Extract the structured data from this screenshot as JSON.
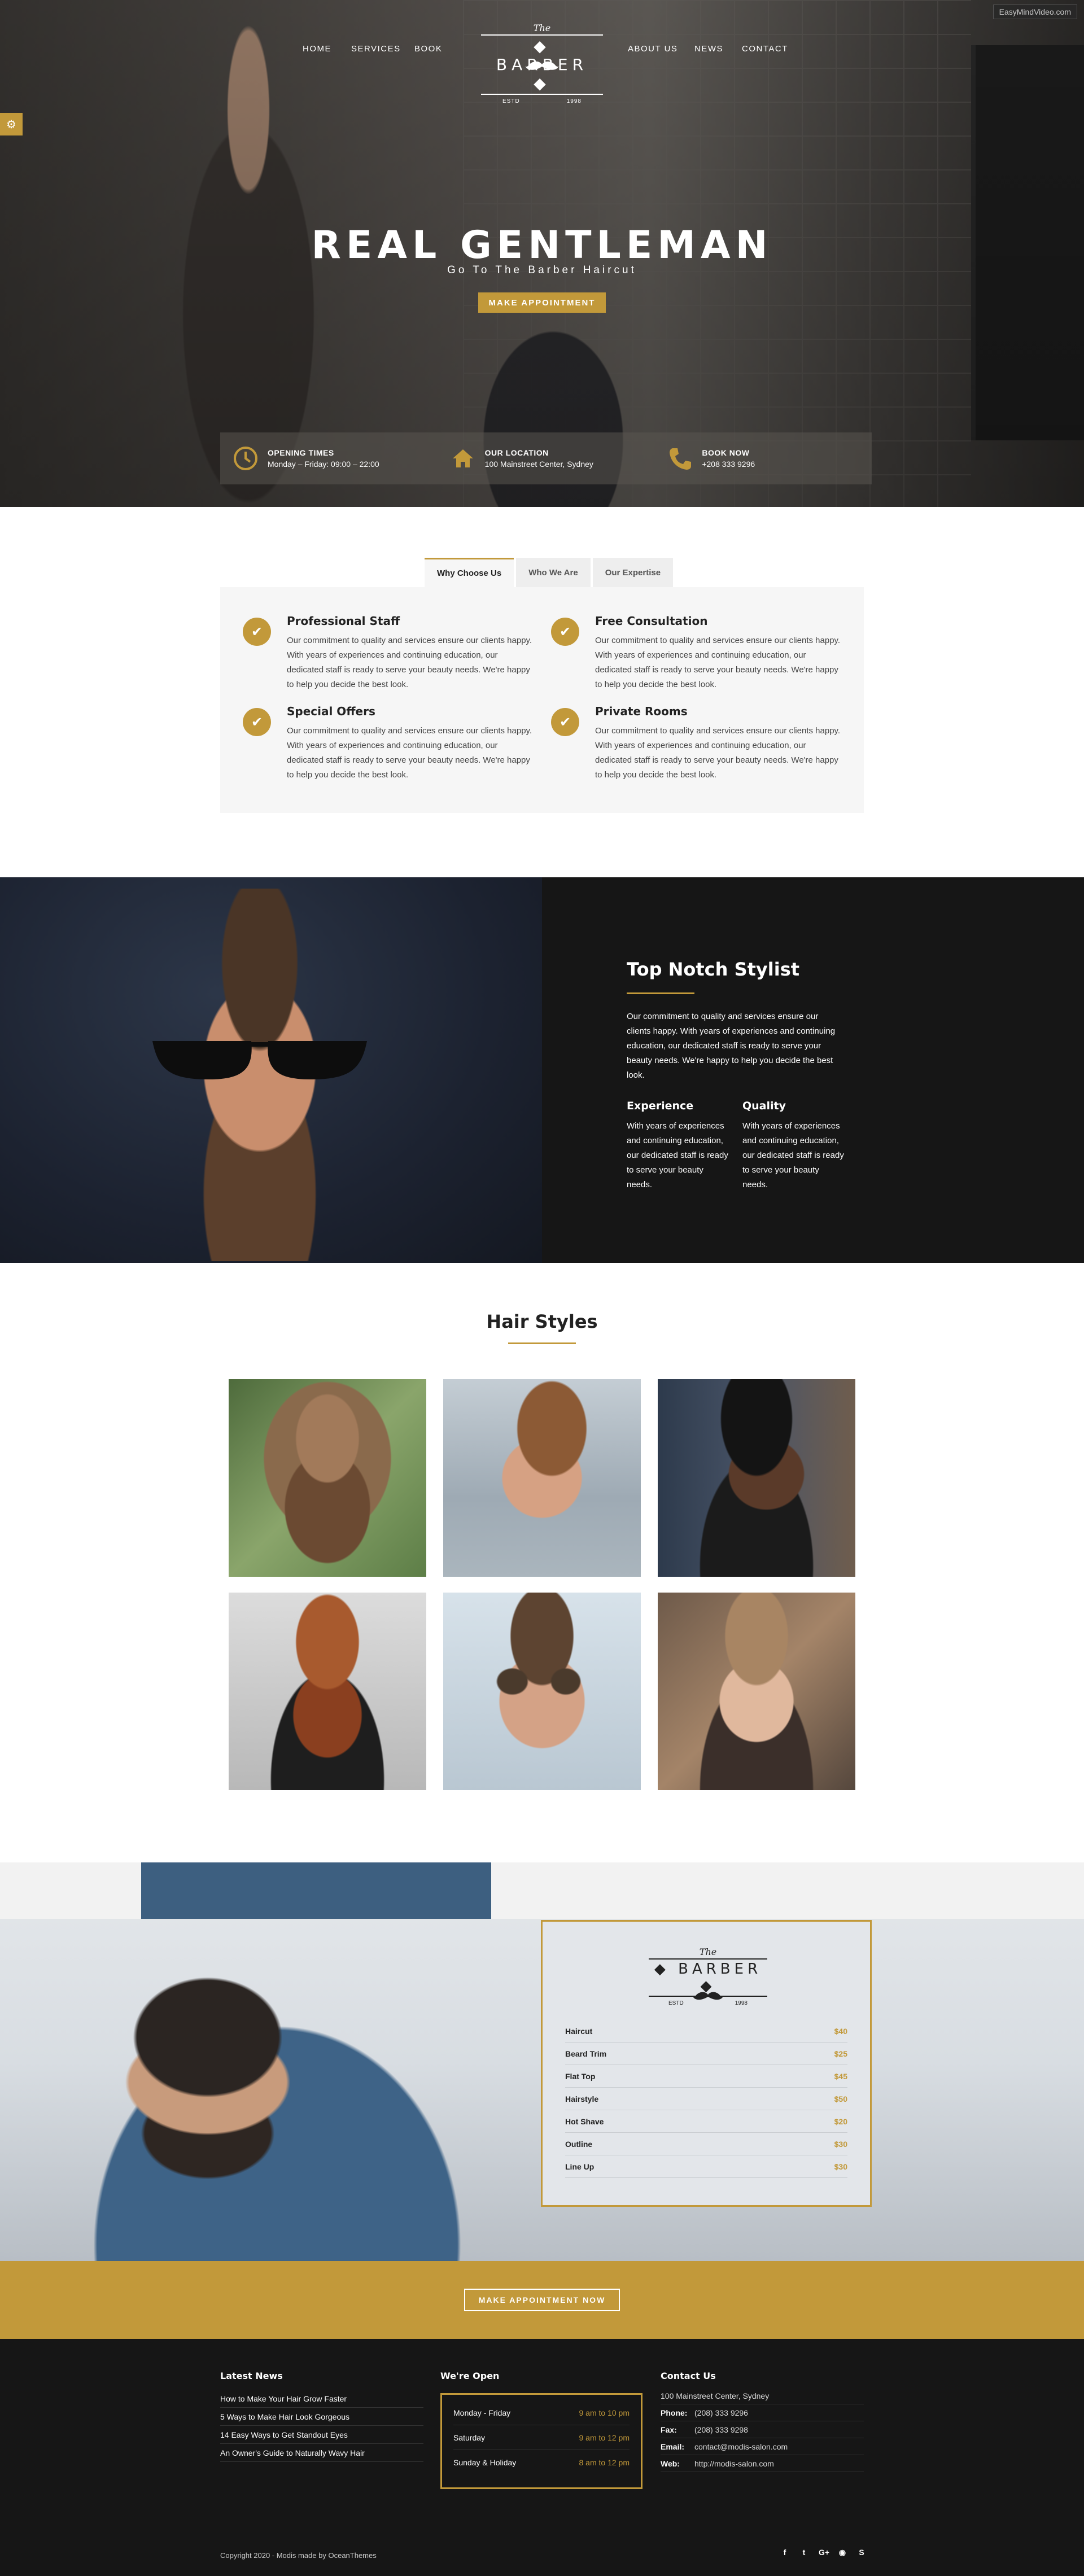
{
  "watermark": "EasyMindVideo.com",
  "nav": {
    "left": [
      "HOME",
      "SERVICES",
      "BOOK"
    ],
    "right": [
      "ABOUT US",
      "NEWS",
      "CONTACT"
    ]
  },
  "logo": {
    "the": "The",
    "name": "BARBER",
    "estd": "ESTD",
    "year": "1998"
  },
  "hero": {
    "title": "REAL GENTLEMAN",
    "subtitle": "Go To The Barber Haircut",
    "button": "MAKE APPOINTMENT"
  },
  "info": [
    {
      "icon": "clock-icon",
      "label": "OPENING TIMES",
      "value": "Monday – Friday: 09:00 – 22:00"
    },
    {
      "icon": "home-icon",
      "label": "OUR LOCATION",
      "value": "100 Mainstreet Center, Sydney"
    },
    {
      "icon": "phone-icon",
      "label": "BOOK NOW",
      "value": "+208 333 9296"
    }
  ],
  "tabs": [
    "Why Choose Us",
    "Who We Are",
    "Our Expertise"
  ],
  "features": [
    {
      "title": "Professional Staff",
      "text": "Our commitment to quality and services ensure our clients happy. With years of experiences and continuing education, our dedicated staff is ready to serve your beauty needs. We're happy to help you decide the best look."
    },
    {
      "title": "Free Consultation",
      "text": "Our commitment to quality and services ensure our clients happy. With years of experiences and continuing education, our dedicated staff is ready to serve your beauty needs. We're happy to help you decide the best look."
    },
    {
      "title": "Special Offers",
      "text": "Our commitment to quality and services ensure our clients happy. With years of experiences and continuing education, our dedicated staff is ready to serve your beauty needs. We're happy to help you decide the best look."
    },
    {
      "title": "Private Rooms",
      "text": "Our commitment to quality and services ensure our clients happy. With years of experiences and continuing education, our dedicated staff is ready to serve your beauty needs. We're happy to help you decide the best look."
    }
  ],
  "stylist": {
    "title": "Top Notch Stylist",
    "intro": "Our commitment to quality and services ensure our clients happy. With years of experiences and continuing education, our dedicated staff is ready to serve your beauty needs. We're happy to help you decide the best look.",
    "cols": [
      {
        "title": "Experience",
        "text": "With years of experiences and continuing education, our dedicated staff is ready to serve your beauty needs."
      },
      {
        "title": "Quality",
        "text": "With years of experiences and continuing education, our dedicated staff is ready to serve your beauty needs."
      }
    ]
  },
  "hairstyles": {
    "title": "Hair Styles"
  },
  "prices": [
    {
      "name": "Haircut",
      "price": "$40"
    },
    {
      "name": "Beard Trim",
      "price": "$25"
    },
    {
      "name": "Flat Top",
      "price": "$45"
    },
    {
      "name": "Hairstyle",
      "price": "$50"
    },
    {
      "name": "Hot Shave",
      "price": "$20"
    },
    {
      "name": "Outline",
      "price": "$30"
    },
    {
      "name": "Line Up",
      "price": "$30"
    }
  ],
  "cta": {
    "button": "MAKE APPOINTMENT NOW"
  },
  "footer": {
    "news_title": "Latest News",
    "news": [
      "How to Make Your Hair Grow Faster",
      "5 Ways to Make Hair Look Gorgeous",
      "14 Easy Ways to Get Standout Eyes",
      "An Owner's Guide to Naturally Wavy Hair"
    ],
    "open_title": "We're Open",
    "hours": [
      {
        "day": "Monday - Friday",
        "time": "9 am to 10 pm"
      },
      {
        "day": "Saturday",
        "time": "9 am to 12 pm"
      },
      {
        "day": "Sunday & Holiday",
        "time": "8 am to 12 pm"
      }
    ],
    "contact_title": "Contact Us",
    "address": "100 Mainstreet Center, Sydney",
    "contact": [
      {
        "label": "Phone:",
        "value": "(208) 333 9296"
      },
      {
        "label": "Fax:",
        "value": "(208) 333 9298"
      },
      {
        "label": "Email:",
        "value": "contact@modis-salon.com"
      },
      {
        "label": "Web:",
        "value": "http://modis-salon.com"
      }
    ],
    "copyright": "Copyright 2020 - Modis made by OceanThemes",
    "socials": [
      "facebook-icon",
      "twitter-icon",
      "google-plus-icon",
      "rss-icon",
      "skype-icon"
    ]
  },
  "colors": {
    "accent": "#c2993a",
    "dark": "#161616"
  }
}
